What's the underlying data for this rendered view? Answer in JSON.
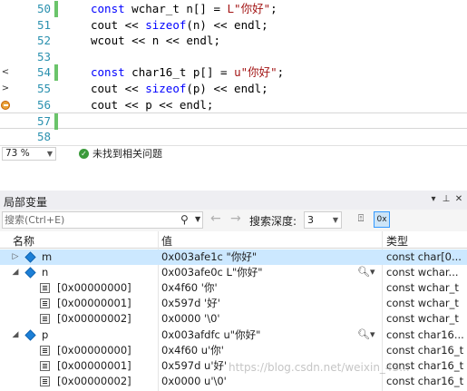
{
  "editor": {
    "lines": [
      {
        "num": "50",
        "tokens": [
          {
            "t": "const wchar_t n[] = ",
            "c": "kw-mix"
          },
          {
            "t": "L\"你好\"",
            "c": "str"
          },
          {
            "t": ";",
            "c": "plain"
          }
        ],
        "gutter": "",
        "changed": true
      },
      {
        "num": "51",
        "tokens": [
          {
            "t": "cout << ",
            "c": "plain"
          },
          {
            "t": "sizeof",
            "c": "kw"
          },
          {
            "t": "(n) << endl;",
            "c": "plain"
          }
        ],
        "gutter": "",
        "changed": false
      },
      {
        "num": "52",
        "tokens": [
          {
            "t": "wcout << n << endl;",
            "c": "plain"
          }
        ],
        "gutter": "",
        "changed": false
      },
      {
        "num": "53",
        "tokens": [],
        "gutter": "",
        "changed": false
      },
      {
        "num": "54",
        "tokens": [
          {
            "t": "const char16_t p[] = ",
            "c": "kw-mix"
          },
          {
            "t": "u\"你好\"",
            "c": "str"
          },
          {
            "t": ";",
            "c": "plain"
          }
        ],
        "gutter": "<",
        "changed": true
      },
      {
        "num": "55",
        "tokens": [
          {
            "t": "cout << ",
            "c": "plain"
          },
          {
            "t": "sizeof",
            "c": "kw"
          },
          {
            "t": "(p) << endl;",
            "c": "plain"
          }
        ],
        "gutter": ">",
        "changed": false
      },
      {
        "num": "56",
        "tokens": [
          {
            "t": "cout << p << endl;",
            "c": "plain"
          }
        ],
        "gutter": "bp",
        "changed": false
      },
      {
        "num": "57",
        "tokens": [],
        "gutter": "",
        "changed": true
      },
      {
        "num": "58",
        "tokens": [],
        "gutter": "",
        "changed": false
      }
    ]
  },
  "status": {
    "zoom": "73 %",
    "issues_text": "未找到相关问题"
  },
  "locals": {
    "title": "局部变量",
    "search_placeholder": "搜索(Ctrl+E)",
    "depth_label": "搜索深度:",
    "depth_value": "3",
    "columns": {
      "name": "名称",
      "value": "值",
      "type": "类型"
    },
    "rows": [
      {
        "level": 0,
        "expander": "right",
        "icon": "cube",
        "name": "m",
        "value": "0x003afe1c \"你好\"",
        "type": "const char[0...",
        "selected": true,
        "magnifier": false
      },
      {
        "level": 0,
        "expander": "down",
        "icon": "cube",
        "name": "n",
        "value": "0x003afe0c L\"你好\"",
        "type": "const wchar...",
        "selected": false,
        "magnifier": true
      },
      {
        "level": 1,
        "expander": "",
        "icon": "field",
        "name": "[0x00000000]",
        "value": "0x4f60 '你'",
        "type": "const wchar_t",
        "selected": false,
        "magnifier": false
      },
      {
        "level": 1,
        "expander": "",
        "icon": "field",
        "name": "[0x00000001]",
        "value": "0x597d '好'",
        "type": "const wchar_t",
        "selected": false,
        "magnifier": false
      },
      {
        "level": 1,
        "expander": "",
        "icon": "field",
        "name": "[0x00000002]",
        "value": "0x0000 '\\0'",
        "type": "const wchar_t",
        "selected": false,
        "magnifier": false
      },
      {
        "level": 0,
        "expander": "down",
        "icon": "cube",
        "name": "p",
        "value": "0x003afdfc u\"你好\"",
        "type": "const char16...",
        "selected": false,
        "magnifier": true
      },
      {
        "level": 1,
        "expander": "",
        "icon": "field",
        "name": "[0x00000000]",
        "value": "0x4f60 u'你'",
        "type": "const char16_t",
        "selected": false,
        "magnifier": false
      },
      {
        "level": 1,
        "expander": "",
        "icon": "field",
        "name": "[0x00000001]",
        "value": "0x597d u'好'",
        "type": "const char16_t",
        "selected": false,
        "magnifier": false
      },
      {
        "level": 1,
        "expander": "",
        "icon": "field",
        "name": "[0x00000002]",
        "value": "0x0000 u'\\0'",
        "type": "const char16_t",
        "selected": false,
        "magnifier": false
      }
    ]
  },
  "watermark": "https://blog.csdn.net/weixin_43..."
}
